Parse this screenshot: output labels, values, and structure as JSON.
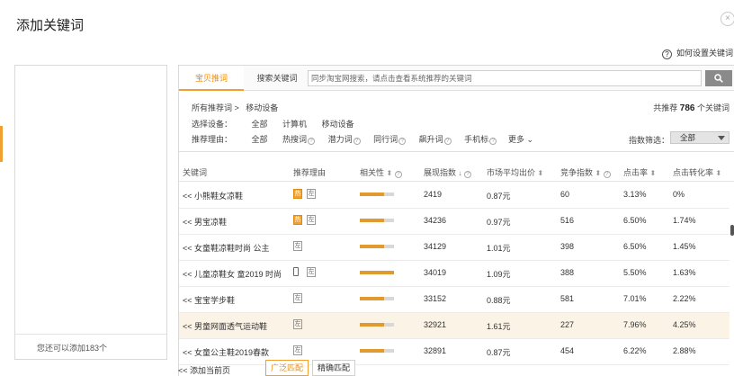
{
  "dialog": {
    "title": "添加关键词",
    "close": "×",
    "help_label": "如何设置关键词"
  },
  "left": {
    "footer": "您还可以添加183个"
  },
  "tabs": [
    {
      "label": "宝贝推词",
      "active": true
    },
    {
      "label": "搜索关键词",
      "active": false
    }
  ],
  "search": {
    "placeholder": "同步淘宝网搜索，请点击查看系统推荐的关键词"
  },
  "breadcrumb": {
    "root": "所有推荐词 >",
    "current": "移动设备"
  },
  "count": {
    "prefix": "共推荐",
    "value": "786",
    "suffix": "个关键词"
  },
  "filters": {
    "device_label": "选择设备：",
    "device_options": [
      "全部",
      "计算机",
      "移动设备"
    ],
    "reason_label": "推荐理由：",
    "reason_options": [
      "全部",
      "热搜词",
      "潜力词",
      "同行词",
      "飙升词",
      "手机标"
    ],
    "more": "更多",
    "index_label": "指数筛选：",
    "index_value": "全部"
  },
  "table": {
    "headers": [
      "关键词",
      "推荐理由",
      "相关性",
      "展现指数",
      "市场平均出价",
      "竞争指数",
      "点击率",
      "点击转化率"
    ],
    "rows": [
      {
        "kw": "<< 小熊鞋女凉鞋",
        "tags": [
          "热",
          "左"
        ],
        "rel": 0.7,
        "impr": "2419",
        "bid": "0.87元",
        "comp": "60",
        "ctr": "3.13%",
        "cvr": "0%"
      },
      {
        "kw": "<< 男宝凉鞋",
        "tags": [
          "热",
          "左"
        ],
        "rel": 0.7,
        "impr": "34236",
        "bid": "0.97元",
        "comp": "516",
        "ctr": "6.50%",
        "cvr": "1.74%"
      },
      {
        "kw": "<< 女童鞋凉鞋时尚 公主",
        "tags": [
          "左"
        ],
        "rel": 0.7,
        "impr": "34129",
        "bid": "1.01元",
        "comp": "398",
        "ctr": "6.50%",
        "cvr": "1.45%"
      },
      {
        "kw": "<< 儿童凉鞋女 童2019 时尚",
        "tags": [
          "dev",
          "左"
        ],
        "rel": 1.0,
        "impr": "34019",
        "bid": "1.09元",
        "comp": "388",
        "ctr": "5.50%",
        "cvr": "1.63%"
      },
      {
        "kw": "<< 宝宝学步鞋",
        "tags": [
          "左"
        ],
        "rel": 0.7,
        "impr": "33152",
        "bid": "0.88元",
        "comp": "581",
        "ctr": "7.01%",
        "cvr": "2.22%"
      },
      {
        "kw": "<< 男童网面透气运动鞋",
        "tags": [
          "左"
        ],
        "rel": 0.7,
        "impr": "32921",
        "bid": "1.61元",
        "comp": "227",
        "ctr": "7.96%",
        "cvr": "4.25%",
        "hl": true
      },
      {
        "kw": "<< 女童公主鞋2019春款",
        "tags": [
          "左"
        ],
        "rel": 0.7,
        "impr": "32891",
        "bid": "0.87元",
        "comp": "454",
        "ctr": "6.22%",
        "cvr": "2.88%"
      }
    ]
  },
  "bottom": {
    "add_page": "<<  添加当前页",
    "broad": "广泛匹配",
    "exact": "精确匹配"
  },
  "colors": {
    "accent": "#f0a030",
    "hot_tag": "#f0a030",
    "row_highlight": "#fbf3e6"
  },
  "icons": {
    "close": "close-icon",
    "help": "help-icon",
    "search": "search-icon",
    "sort": "sort-arrow-icon"
  }
}
